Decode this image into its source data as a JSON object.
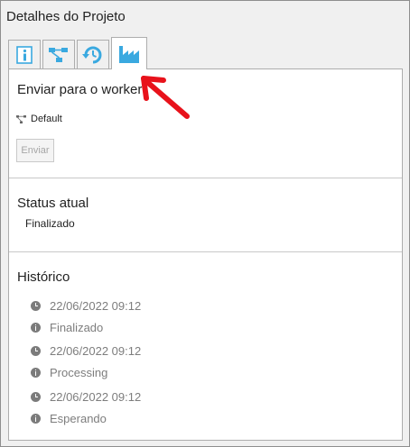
{
  "window": {
    "title": "Detalhes do Projeto"
  },
  "tabs": [
    {
      "icon": "info-icon",
      "active": false
    },
    {
      "icon": "workflow-icon",
      "active": false
    },
    {
      "icon": "history-icon",
      "active": false
    },
    {
      "icon": "factory-icon",
      "active": true
    }
  ],
  "send_section": {
    "title": "Enviar para o worker",
    "worker_name": "Default",
    "send_label": "Enviar"
  },
  "status_section": {
    "title": "Status atual",
    "value": "Finalizado"
  },
  "history_section": {
    "title": "Histórico",
    "entries": [
      {
        "time": "22/06/2022 09:12",
        "status": "Finalizado"
      },
      {
        "time": "22/06/2022 09:12",
        "status": "Processing"
      },
      {
        "time": "22/06/2022 09:12",
        "status": "Esperando"
      }
    ]
  },
  "colors": {
    "accent": "#3aa9e0",
    "annotation": "#e8121b"
  }
}
